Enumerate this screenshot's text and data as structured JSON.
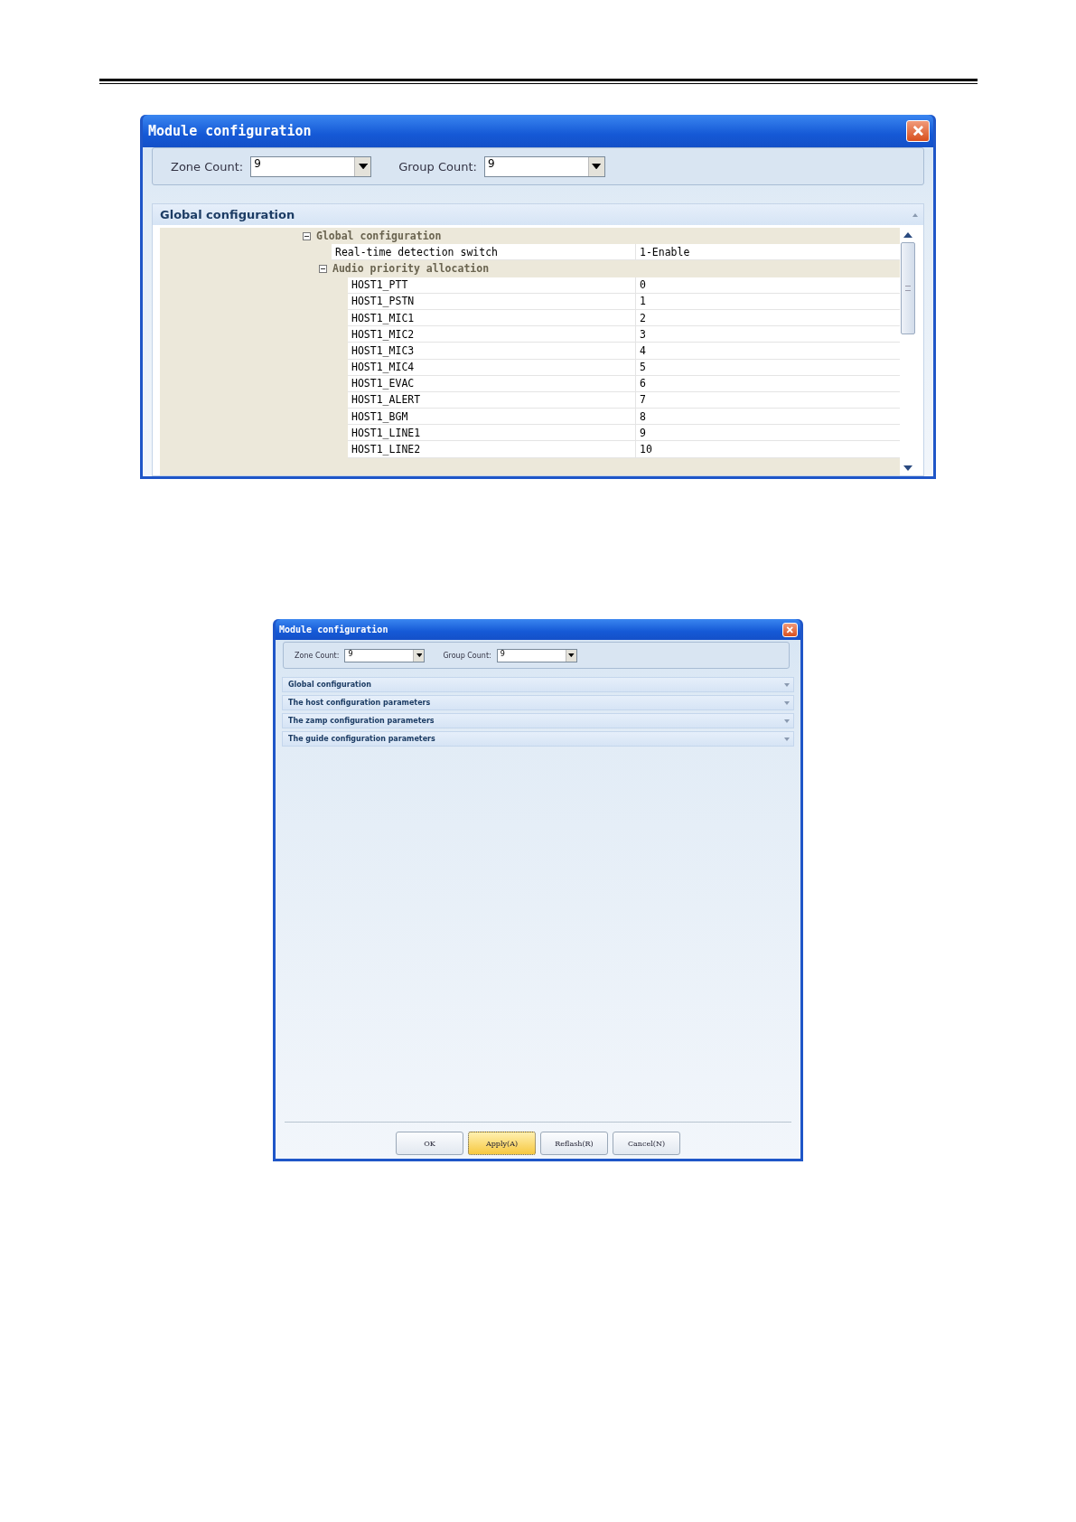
{
  "windows": [
    {
      "title": "Module configuration",
      "zone_count": {
        "label": "Zone Count:",
        "value": "9"
      },
      "group_count": {
        "label": "Group Count:",
        "value": "9"
      },
      "sections": [
        {
          "title": "Global configuration",
          "expanded": true,
          "grid": [
            {
              "kind": "category",
              "name": "Global configuration",
              "expanded": true,
              "children": [
                {
                  "kind": "property",
                  "name": "Real-time detection switch",
                  "value": "1-Enable"
                },
                {
                  "kind": "category",
                  "name": "Audio priority allocation",
                  "expanded": true,
                  "children": [
                    {
                      "kind": "property",
                      "name": "HOST1_PTT",
                      "value": "0"
                    },
                    {
                      "kind": "property",
                      "name": "HOST1_PSTN",
                      "value": "1"
                    },
                    {
                      "kind": "property",
                      "name": "HOST1_MIC1",
                      "value": "2"
                    },
                    {
                      "kind": "property",
                      "name": "HOST1_MIC2",
                      "value": "3"
                    },
                    {
                      "kind": "property",
                      "name": "HOST1_MIC3",
                      "value": "4"
                    },
                    {
                      "kind": "property",
                      "name": "HOST1_MIC4",
                      "value": "5"
                    },
                    {
                      "kind": "property",
                      "name": "HOST1_EVAC",
                      "value": "6"
                    },
                    {
                      "kind": "property",
                      "name": "HOST1_ALERT",
                      "value": "7"
                    },
                    {
                      "kind": "property",
                      "name": "HOST1_BGM",
                      "value": "8"
                    },
                    {
                      "kind": "property",
                      "name": "HOST1_LINE1",
                      "value": "9"
                    },
                    {
                      "kind": "property",
                      "name": "HOST1_LINE2",
                      "value": "10"
                    }
                  ]
                }
              ]
            }
          ]
        }
      ]
    },
    {
      "title": "Module configuration",
      "zone_count": {
        "label": "Zone Count:",
        "value": "9"
      },
      "group_count": {
        "label": "Group Count:",
        "value": "9"
      },
      "sections": [
        {
          "title": "Global configuration",
          "expanded": false
        },
        {
          "title": "The host configuration parameters",
          "expanded": false
        },
        {
          "title": "The zamp configuration parameters",
          "expanded": false
        },
        {
          "title": "The guide configuration parameters",
          "expanded": false
        }
      ],
      "buttons": [
        {
          "label": "OK",
          "selected": false
        },
        {
          "label": "Apply(A)",
          "selected": true
        },
        {
          "label": "Reflash(R)",
          "selected": false
        },
        {
          "label": "Cancel(N)",
          "selected": false
        }
      ]
    }
  ]
}
